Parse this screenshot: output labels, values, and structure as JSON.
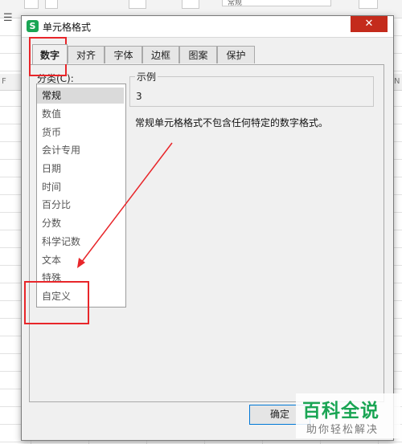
{
  "background": {
    "format_combo": "常规",
    "col_left": "F",
    "col_right": "N"
  },
  "dialog": {
    "title": "单元格格式",
    "app_icon_letter": "S",
    "close_symbol": "✕",
    "tabs": [
      {
        "label": "数字",
        "active": true
      },
      {
        "label": "对齐"
      },
      {
        "label": "字体"
      },
      {
        "label": "边框"
      },
      {
        "label": "图案"
      },
      {
        "label": "保护"
      }
    ],
    "category_label": "分类(C):",
    "categories": [
      {
        "label": "常规",
        "selected": true
      },
      {
        "label": "数值"
      },
      {
        "label": "货币"
      },
      {
        "label": "会计专用"
      },
      {
        "label": "日期"
      },
      {
        "label": "时间"
      },
      {
        "label": "百分比"
      },
      {
        "label": "分数"
      },
      {
        "label": "科学记数"
      },
      {
        "label": "文本"
      },
      {
        "label": "特殊"
      },
      {
        "label": "自定义"
      }
    ],
    "sample_legend": "示例",
    "sample_value": "3",
    "description": "常规单元格格式不包含任何特定的数字格式。",
    "ok_label": "确定"
  },
  "annotation_color": "#e8262a",
  "watermark": {
    "title": "百科全说",
    "subtitle": "助你轻松解决"
  }
}
